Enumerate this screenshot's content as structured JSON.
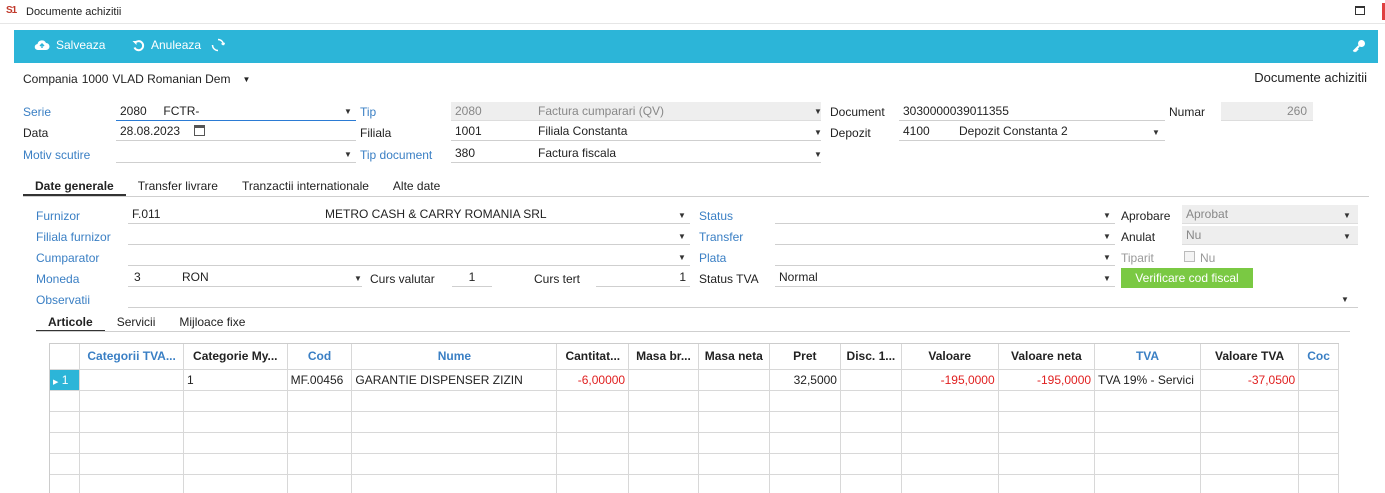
{
  "window": {
    "logo": "S1",
    "title": "Documente achizitii"
  },
  "toolbar": {
    "save": "Salveaza",
    "cancel": "Anuleaza"
  },
  "company": {
    "label": "Compania",
    "code": "1000",
    "name": "VLAD Romanian Dem"
  },
  "doc_title": "Documente achizitii",
  "header": {
    "serie_label": "Serie",
    "serie_code": "2080",
    "serie_name": "FCTR-",
    "tip_label": "Tip",
    "tip_code": "2080",
    "tip_name": "Factura cumparari (QV)",
    "document_label": "Document",
    "document_value": "3030000039011355",
    "numar_label": "Numar",
    "numar_value": "260",
    "data_label": "Data",
    "data_value": "28.08.2023",
    "filiala_label": "Filiala",
    "filiala_code": "1001",
    "filiala_name": "Filiala Constanta",
    "depozit_label": "Depozit",
    "depozit_code": "4100",
    "depozit_name": "Depozit Constanta 2",
    "motiv_label": "Motiv scutire",
    "motiv_value": "",
    "tipdoc_label": "Tip document",
    "tipdoc_code": "380",
    "tipdoc_name": "Factura fiscala"
  },
  "tabs": [
    "Date generale",
    "Transfer livrare",
    "Tranzactii internationale",
    "Alte date"
  ],
  "general": {
    "furnizor_label": "Furnizor",
    "furnizor_code": "F.011",
    "furnizor_name": "METRO CASH & CARRY ROMANIA SRL",
    "filiala_furnizor_label": "Filiala furnizor",
    "cumparator_label": "Cumparator",
    "moneda_label": "Moneda",
    "moneda_code": "3",
    "moneda_name": "RON",
    "curs_valutar_label": "Curs valutar",
    "curs_valutar_value": "1",
    "curs_tert_label": "Curs tert",
    "curs_tert_value": "1",
    "observatii_label": "Observatii",
    "status_label": "Status",
    "transfer_label": "Transfer",
    "plata_label": "Plata",
    "status_tva_label": "Status TVA",
    "status_tva_value": "Normal",
    "aprobare_label": "Aprobare",
    "aprobare_value": "Aprobat",
    "anulat_label": "Anulat",
    "anulat_value": "Nu",
    "tiparit_label": "Tiparit",
    "tiparit_value": "Nu",
    "verify_button": "Verificare cod fiscal"
  },
  "subtabs": [
    "Articole",
    "Servicii",
    "Mijloace fixe"
  ],
  "grid": {
    "columns": [
      "Categorii TVA...",
      "Categorie My...",
      "Cod",
      "Nume",
      "Cantitat...",
      "Masa br...",
      "Masa neta",
      "Pret",
      "Disc. 1...",
      "Valoare",
      "Valoare neta",
      "TVA",
      "Valoare TVA",
      "Coc"
    ],
    "rows": [
      {
        "indicator": "1",
        "categorii_tva": "",
        "categorie_my": "1",
        "cod": "MF.00456",
        "nume": "GARANTIE DISPENSER ZIZIN",
        "cantitate": "-6,00000",
        "masa_bruta": "",
        "masa_neta": "",
        "pret": "32,5000",
        "disc": "",
        "valoare": "-195,0000",
        "valoare_neta": "-195,0000",
        "tva": "TVA 19% - Servici",
        "valoare_tva": "-37,0500",
        "coc": ""
      }
    ]
  },
  "colors": {
    "toolbar": "#2cb5d8",
    "link_label": "#3a7fc4",
    "negative": "#e02020",
    "verify_button": "#7ac943"
  }
}
